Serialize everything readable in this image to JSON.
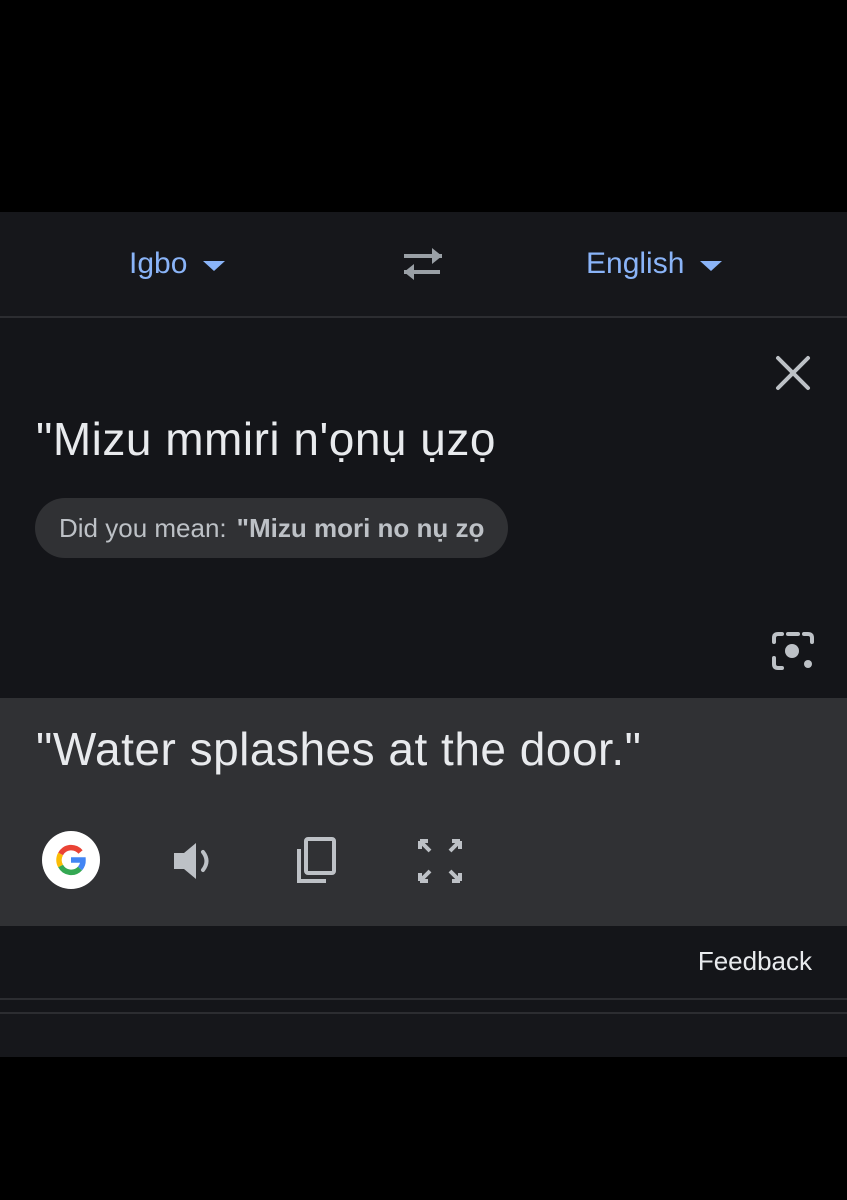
{
  "languages": {
    "source": "Igbo",
    "target": "English"
  },
  "input": {
    "text": "\"Mizu mmiri n'ọnụ ụzọ",
    "suggestion_label": "Did you mean:",
    "suggestion_value": "\"Mizu mori no nụ zọ"
  },
  "output": {
    "text": "\"Water splashes at the door.\""
  },
  "footer": {
    "feedback": "Feedback"
  },
  "icons": {
    "swap": "swap-arrows-icon",
    "close": "close-icon",
    "lens": "camera-lens-icon",
    "google": "google-logo-icon",
    "speaker": "speaker-icon",
    "copy": "copy-icon",
    "expand": "fullscreen-icon"
  },
  "colors": {
    "accent": "#8ab4f8",
    "background": "#141519",
    "output_background": "#303134",
    "text": "#e8eaed"
  }
}
